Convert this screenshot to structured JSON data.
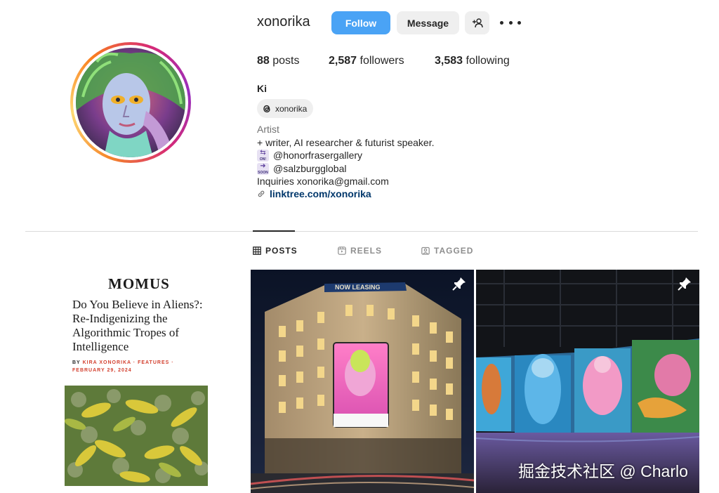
{
  "profile": {
    "username": "xonorika",
    "follow_label": "Follow",
    "message_label": "Message",
    "stats": {
      "posts_count": "88",
      "posts_label": "posts",
      "followers_count": "2,587",
      "followers_label": "followers",
      "following_count": "3,583",
      "following_label": "following"
    },
    "full_name": "Ki",
    "threads_handle": "xonorika",
    "category": "Artist",
    "bio_lines": [
      "+ writer, AI researcher & futurist speaker.",
      "@honorfrasergallery",
      "@salzburgglobal",
      "Inquiries xonorika@gmail.com"
    ],
    "emoji_labels": [
      "ON!",
      "SOON"
    ],
    "link": "linktree.com/xonorika"
  },
  "tabs": [
    {
      "label": "POSTS",
      "active": true
    },
    {
      "label": "REELS",
      "active": false
    },
    {
      "label": "TAGGED",
      "active": false
    }
  ],
  "posts": [
    {
      "logo": "MOMUS",
      "title": "Do You Believe in Aliens?: Re-Indigenizing the Algorithmic Tropes of Intelligence",
      "byline_by": "BY",
      "byline_author": "KIRA XONORIKA",
      "byline_sep": "·",
      "byline_section": "FEATURES",
      "byline_sep2": "·",
      "date": "FEBRUARY 29, 2024"
    },
    {
      "building_sign": "NOW LEASING",
      "pinned": true
    },
    {
      "pinned": true
    }
  ],
  "watermark": "掘金技术社区 @ Charlo",
  "colors": {
    "follow_button": "#4aa3f5",
    "link": "#00376b",
    "accent_red": "#d3402f"
  },
  "icons": {
    "add_user": "add-user-icon",
    "more": "more-icon",
    "threads": "threads-icon",
    "link": "link-icon",
    "grid": "grid-icon",
    "reels": "reels-icon",
    "tagged": "tagged-icon",
    "pin": "pin-icon"
  }
}
